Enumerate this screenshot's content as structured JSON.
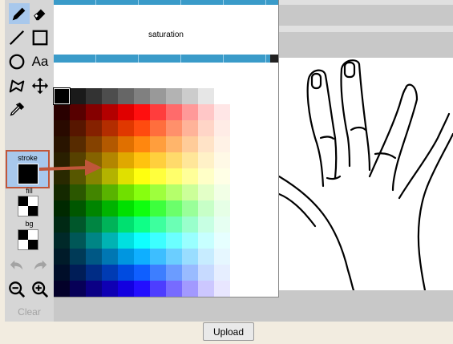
{
  "toolbar": {
    "tools": [
      {
        "name": "pencil-icon",
        "active": true
      },
      {
        "name": "eraser-icon",
        "active": false
      },
      {
        "name": "line-icon",
        "active": false
      },
      {
        "name": "rectangle-icon",
        "active": false
      },
      {
        "name": "ellipse-icon",
        "active": false
      },
      {
        "name": "text-tool-label",
        "label": "Aa",
        "active": false
      },
      {
        "name": "polygon-icon",
        "active": false
      },
      {
        "name": "move-icon",
        "active": false
      },
      {
        "name": "eyedropper-icon",
        "active": false
      }
    ],
    "stroke_label": "stroke",
    "fill_label": "fill",
    "bg_label": "bg",
    "stroke_color": "#000000",
    "clear_label": "Clear",
    "history": [
      "undo-icon",
      "redo-icon"
    ],
    "zoom": [
      "zoom-out-icon",
      "zoom-in-icon"
    ]
  },
  "picker": {
    "saturation_label": "saturation",
    "slider_color": "#3a9bc9"
  },
  "upload_label": "Upload",
  "annotation_color": "#c0563a"
}
